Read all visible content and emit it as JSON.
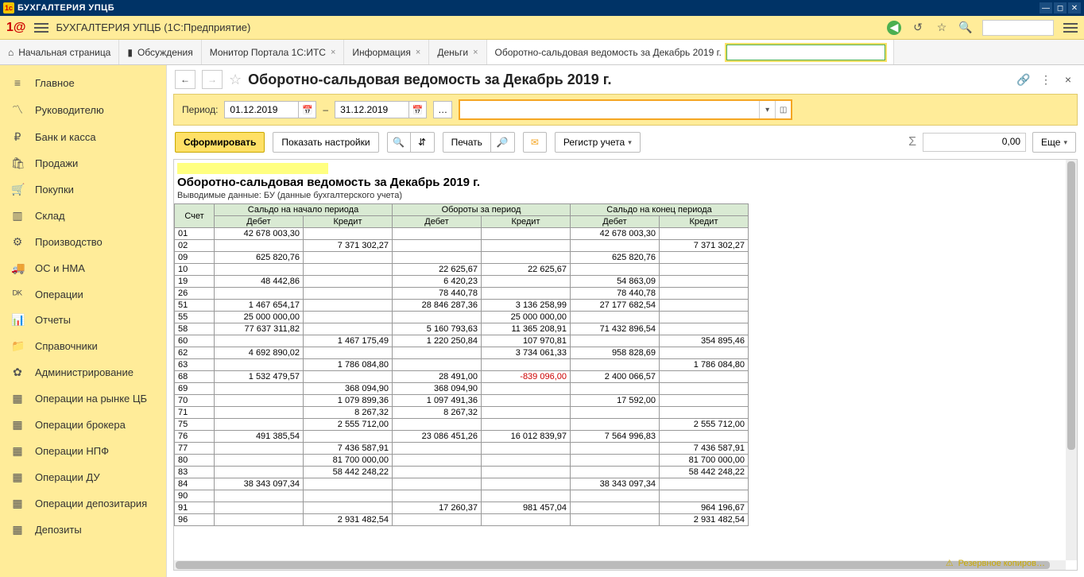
{
  "window": {
    "title": "БУХГАЛТЕРИЯ УПЦБ"
  },
  "app_header": {
    "title": "БУХГАЛТЕРИЯ УПЦБ  (1С:Предприятие)"
  },
  "tabs": {
    "home": "Начальная страница",
    "discuss": "Обсуждения",
    "monitor": "Монитор Портала 1С:ИТС",
    "info": "Информация",
    "money": "Деньги",
    "active": "Оборотно-сальдовая ведомость за Декабрь 2019 г."
  },
  "sidebar": {
    "items": [
      {
        "icon": "≡",
        "label": "Главное"
      },
      {
        "icon": "〽",
        "label": "Руководителю"
      },
      {
        "icon": "₽",
        "label": "Банк и касса"
      },
      {
        "icon": "🛍",
        "label": "Продажи"
      },
      {
        "icon": "🛒",
        "label": "Покупки"
      },
      {
        "icon": "▥",
        "label": "Склад"
      },
      {
        "icon": "⚙",
        "label": "Производство"
      },
      {
        "icon": "🚚",
        "label": "ОС и НМА"
      },
      {
        "icon": "ᴰᴷ",
        "label": "Операции"
      },
      {
        "icon": "📊",
        "label": "Отчеты"
      },
      {
        "icon": "📁",
        "label": "Справочники"
      },
      {
        "icon": "✿",
        "label": "Администрирование"
      },
      {
        "icon": "▦",
        "label": "Операции на рынке ЦБ"
      },
      {
        "icon": "▦",
        "label": "Операции брокера"
      },
      {
        "icon": "▦",
        "label": "Операции НПФ"
      },
      {
        "icon": "▦",
        "label": "Операции ДУ"
      },
      {
        "icon": "▦",
        "label": "Операции депозитария"
      },
      {
        "icon": "▦",
        "label": "Депозиты"
      }
    ]
  },
  "page": {
    "title": "Оборотно-сальдовая ведомость за Декабрь 2019 г.",
    "period_label": "Период:",
    "date_from": "01.12.2019",
    "date_to": "31.12.2019",
    "filter_value": ""
  },
  "toolbar": {
    "form": "Сформировать",
    "settings": "Показать настройки",
    "print": "Печать",
    "register": "Регистр учета",
    "more": "Еще",
    "sum_display": "0,00"
  },
  "report": {
    "title": "Оборотно-сальдовая ведомость за Декабрь 2019 г.",
    "subtitle": "Выводимые данные:   БУ (данные бухгалтерского учета)",
    "headers": {
      "acct": "Счет",
      "start": "Сальдо на начало периода",
      "turn": "Обороты за период",
      "end": "Сальдо на конец периода",
      "debit": "Дебет",
      "credit": "Кредит"
    },
    "rows": [
      {
        "acct": "01",
        "sd": "42 678 003,30",
        "sc": "",
        "td": "",
        "tc": "",
        "ed": "42 678 003,30",
        "ec": ""
      },
      {
        "acct": "02",
        "sd": "",
        "sc": "7 371 302,27",
        "td": "",
        "tc": "",
        "ed": "",
        "ec": "7 371 302,27"
      },
      {
        "acct": "09",
        "sd": "625 820,76",
        "sc": "",
        "td": "",
        "tc": "",
        "ed": "625 820,76",
        "ec": ""
      },
      {
        "acct": "10",
        "sd": "",
        "sc": "",
        "td": "22 625,67",
        "tc": "22 625,67",
        "ed": "",
        "ec": ""
      },
      {
        "acct": "19",
        "sd": "48 442,86",
        "sc": "",
        "td": "6 420,23",
        "tc": "",
        "ed": "54 863,09",
        "ec": ""
      },
      {
        "acct": "26",
        "sd": "",
        "sc": "",
        "td": "78 440,78",
        "tc": "",
        "ed": "78 440,78",
        "ec": ""
      },
      {
        "acct": "51",
        "sd": "1 467 654,17",
        "sc": "",
        "td": "28 846 287,36",
        "tc": "3 136 258,99",
        "ed": "27 177 682,54",
        "ec": ""
      },
      {
        "acct": "55",
        "sd": "25 000 000,00",
        "sc": "",
        "td": "",
        "tc": "25 000 000,00",
        "ed": "",
        "ec": ""
      },
      {
        "acct": "58",
        "sd": "77 637 311,82",
        "sc": "",
        "td": "5 160 793,63",
        "tc": "11 365 208,91",
        "ed": "71 432 896,54",
        "ec": ""
      },
      {
        "acct": "60",
        "sd": "",
        "sc": "1 467 175,49",
        "td": "1 220 250,84",
        "tc": "107 970,81",
        "ed": "",
        "ec": "354 895,46"
      },
      {
        "acct": "62",
        "sd": "4 692 890,02",
        "sc": "",
        "td": "",
        "tc": "3 734 061,33",
        "ed": "958 828,69",
        "ec": ""
      },
      {
        "acct": "63",
        "sd": "",
        "sc": "1 786 084,80",
        "td": "",
        "tc": "",
        "ed": "",
        "ec": "1 786 084,80"
      },
      {
        "acct": "68",
        "sd": "1 532 479,57",
        "sc": "",
        "td": "28 491,00",
        "tc": "-839 096,00",
        "tc_neg": true,
        "ed": "2 400 066,57",
        "ec": ""
      },
      {
        "acct": "69",
        "sd": "",
        "sc": "368 094,90",
        "td": "368 094,90",
        "tc": "",
        "ed": "",
        "ec": ""
      },
      {
        "acct": "70",
        "sd": "",
        "sc": "1 079 899,36",
        "td": "1 097 491,36",
        "tc": "",
        "ed": "17 592,00",
        "ec": ""
      },
      {
        "acct": "71",
        "sd": "",
        "sc": "8 267,32",
        "td": "8 267,32",
        "tc": "",
        "ed": "",
        "ec": ""
      },
      {
        "acct": "75",
        "sd": "",
        "sc": "2 555 712,00",
        "td": "",
        "tc": "",
        "ed": "",
        "ec": "2 555 712,00"
      },
      {
        "acct": "76",
        "sd": "491 385,54",
        "sc": "",
        "td": "23 086 451,26",
        "tc": "16 012 839,97",
        "ed": "7 564 996,83",
        "ec": ""
      },
      {
        "acct": "77",
        "sd": "",
        "sc": "7 436 587,91",
        "td": "",
        "tc": "",
        "ed": "",
        "ec": "7 436 587,91"
      },
      {
        "acct": "80",
        "sd": "",
        "sc": "81 700 000,00",
        "td": "",
        "tc": "",
        "ed": "",
        "ec": "81 700 000,00"
      },
      {
        "acct": "83",
        "sd": "",
        "sc": "58 442 248,22",
        "td": "",
        "tc": "",
        "ed": "",
        "ec": "58 442 248,22"
      },
      {
        "acct": "84",
        "sd": "38 343 097,34",
        "sc": "",
        "td": "",
        "tc": "",
        "ed": "38 343 097,34",
        "ec": ""
      },
      {
        "acct": "90",
        "sd": "",
        "sc": "",
        "td": "",
        "tc": "",
        "ed": "",
        "ec": ""
      },
      {
        "acct": "91",
        "sd": "",
        "sc": "",
        "td": "17 260,37",
        "tc": "981 457,04",
        "ed": "",
        "ec": "964 196,67"
      },
      {
        "acct": "96",
        "sd": "",
        "sc": "2 931 482,54",
        "td": "",
        "tc": "",
        "ed": "",
        "ec": "2 931 482,54"
      }
    ]
  },
  "status": {
    "backup": "Резервное копиров…"
  }
}
